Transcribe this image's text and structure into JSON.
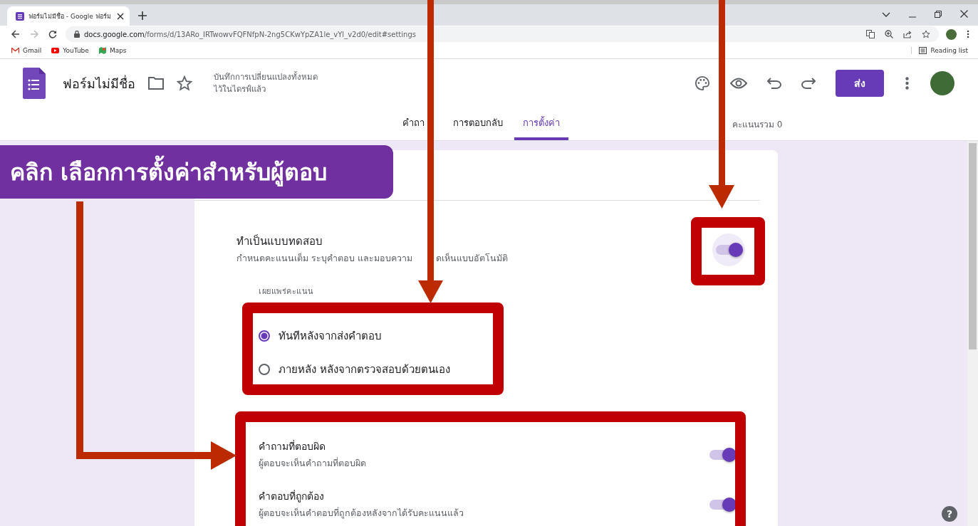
{
  "browser": {
    "tab_title": "ฟอร์มไม่มีชื่อ - Google ฟอร์ม",
    "url_host": "docs.google.com",
    "url_path": "/forms/d/13ARo_IRTwowvFQFNfpN-2ng5CKwYpZA1le_vYl_v2d0/edit#settings",
    "bookmarks": [
      "Gmail",
      "YouTube",
      "Maps"
    ],
    "reading_list": "Reading list"
  },
  "form_header": {
    "title": "ฟอร์มไม่มีชื่อ",
    "save_status": [
      "บันทึกการเปลี่ยนแปลงทั้งหมด",
      "ไว้ในไดรฟ์แล้ว"
    ],
    "send_button": "ส่ง",
    "tabs": [
      {
        "label": "คำถา",
        "selected": false
      },
      {
        "label": "การตอบกลับ",
        "selected": false
      },
      {
        "label": "การตั้งค่า",
        "selected": true
      }
    ],
    "total_points": "คะแนนรวม 0"
  },
  "quiz": {
    "title": "ทำเป็นแบบทดสอบ",
    "description_parts": [
      "กำหนดคะแนนเต็ม ระบุคำตอบ และมอบความ",
      "ดเห็นแบบอัตโนมัติ"
    ],
    "on": true
  },
  "release_grade": {
    "label": "เผยแพร่คะแนน",
    "options": [
      {
        "label": "ทันทีหลังจากส่งคำตอบ",
        "selected": true
      },
      {
        "label": "ภายหลัง หลังจากตรวจสอบด้วยตนเอง",
        "selected": false
      }
    ]
  },
  "respondent_settings": [
    {
      "title": "คำถามที่ตอบผิด",
      "description": "ผู้ตอบจะเห็นคำถามที่ตอบผิด",
      "on": true
    },
    {
      "title": "คำตอบที่ถูกต้อง",
      "description": "ผู้ตอบจะเห็นคำตอบที่ถูกต้องหลังจากได้รับคะแนนแล้ว",
      "on": true
    }
  ],
  "annotation": {
    "callout": "คลิก เลือกการตั้งค่าสำหรับผู้ตอบ"
  },
  "help_button": "?"
}
